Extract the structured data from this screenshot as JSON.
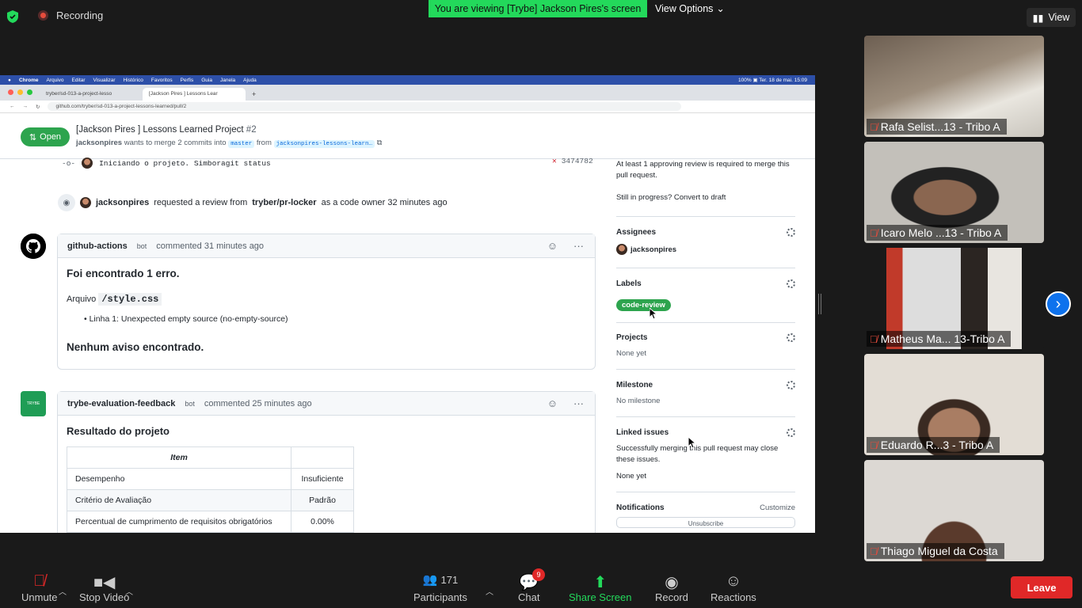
{
  "top": {
    "recording": "Recording",
    "banner": "You are viewing [Trybe] Jackson Pires's screen",
    "view_options": "View Options",
    "view": "View"
  },
  "browser": {
    "menu": [
      "Chrome",
      "Arquivo",
      "Editar",
      "Visualizar",
      "Histórico",
      "Favoritos",
      "Perfis",
      "Guia",
      "Janela",
      "Ajuda"
    ],
    "status": "100% ▣   Ter. 18 de mai. 15:09",
    "tabs": [
      "tryber/sd-013-a-project-lesso",
      "[Jackson Pires ] Lessons Lear"
    ],
    "url": "github.com/tryber/sd-013-a-project-lessons-learned/pull/2"
  },
  "pr": {
    "state": "Open",
    "title": "[Jackson Pires ] Lessons Learned Project",
    "number": "#2",
    "author": "jacksonpires",
    "sub_mid": "wants to merge 2 commits into",
    "base": "master",
    "from": "from",
    "head": "jacksonpires-lessons-learn…"
  },
  "timeline": {
    "commit_msg": "Iniciando o projeto. Simboragit status",
    "commit_sha": "3474782",
    "review_user": "jacksonpires",
    "review_text1": "requested a review from",
    "review_team": "tryber/pr-locker",
    "review_text2": "as a code owner 32 minutes ago"
  },
  "comment1": {
    "author": "github-actions",
    "badge": "bot",
    "time": "commented 31 minutes ago",
    "heading": "Foi encontrado 1 erro.",
    "file_label": "Arquivo",
    "file": "/style.css",
    "bullet": "Linha 1: Unexpected empty source (no-empty-source)",
    "no_warn": "Nenhum aviso encontrado."
  },
  "comment2": {
    "icon_text": "TRYBE",
    "author": "trybe-evaluation-feedback",
    "badge": "bot",
    "time": "commented 25 minutes ago",
    "heading": "Resultado do projeto",
    "table_header": "Item",
    "rows": [
      {
        "item": "Desempenho",
        "value": "Insuficiente"
      },
      {
        "item": "Critério de Avaliação",
        "value": "Padrão"
      },
      {
        "item": "Percentual de cumprimento de requisitos obrigatórios",
        "value": "0.00%"
      }
    ]
  },
  "sidebar": {
    "review_req": "At least 1 approving review is required to merge this pull request.",
    "draft": "Still in progress? Convert to draft",
    "assignees": "Assignees",
    "assignee": "jacksonpires",
    "labels": "Labels",
    "label": "code-review",
    "projects": "Projects",
    "projects_val": "None yet",
    "milestone": "Milestone",
    "milestone_val": "No milestone",
    "linked": "Linked issues",
    "linked_desc": "Successfully merging this pull request may close these issues.",
    "linked_val": "None yet",
    "notifications": "Notifications",
    "customize": "Customize",
    "unsubscribe": "Unsubscribe"
  },
  "participants": [
    {
      "name": "Rafa Selist...13 - Tribo A",
      "bg": "#8a7a6a"
    },
    {
      "name": "Icaro Melo ...13 - Tribo A",
      "bg": "#b9b4ad"
    },
    {
      "name": "Matheus Ma... 13-Tribo A",
      "bg": "#c9c2bb"
    },
    {
      "name": "Eduardo  R...3 - Tribo A",
      "bg": "#d8cdbf"
    },
    {
      "name": "Thiago Miguel da Costa",
      "bg": "#cfcac5"
    }
  ],
  "bottom": {
    "unmute": "Unmute",
    "stop_video": "Stop Video",
    "participants_count": "171",
    "participants": "Participants",
    "chat": "Chat",
    "chat_badge": "9",
    "share": "Share Screen",
    "record": "Record",
    "reactions": "Reactions",
    "leave": "Leave"
  },
  "colors": {
    "share_green": "#23d95b",
    "leave_red": "#e02828",
    "zoom_blue": "#0e72ed"
  }
}
